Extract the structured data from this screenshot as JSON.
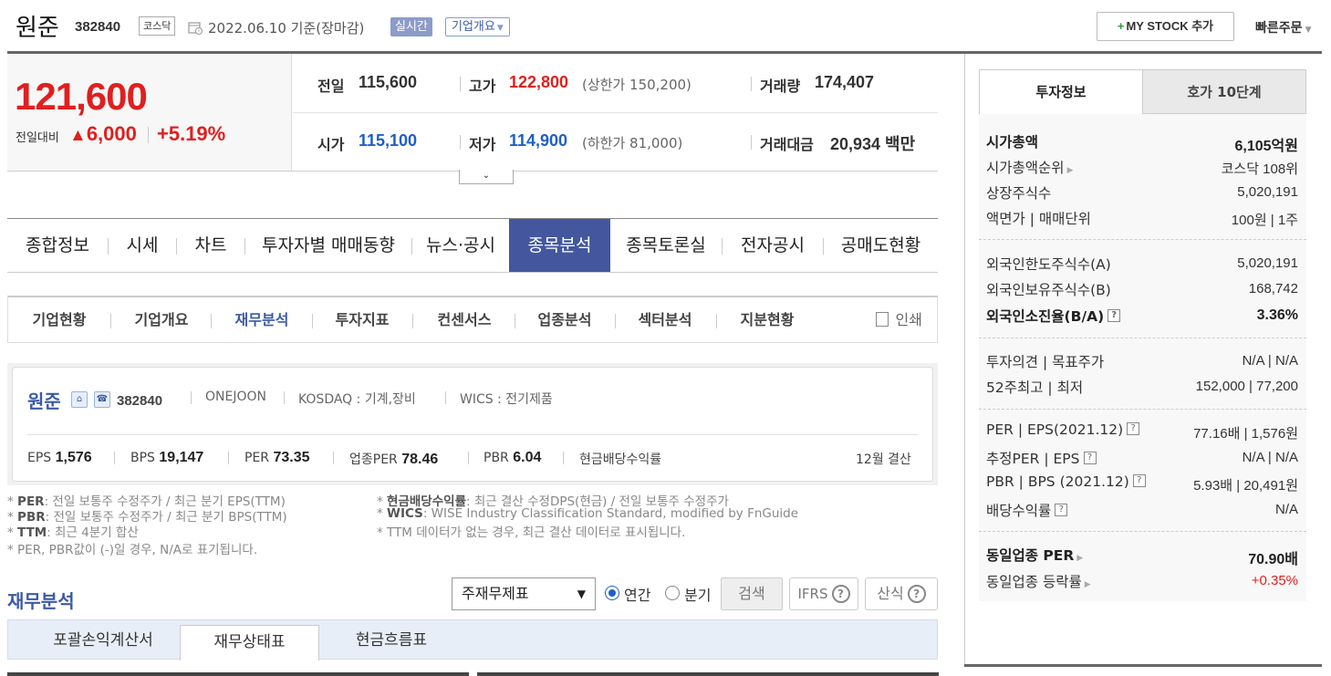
{
  "header": {
    "name": "원준",
    "code": "382840",
    "market_badge": "코스닥",
    "date": "2022.06.10  기준(장마감)",
    "realtime": "실시간",
    "overview": "기업개요",
    "mystock": "MY STOCK 추가",
    "quick_order": "빠른주문"
  },
  "price": {
    "current": "121,600",
    "change_label": "전일대비",
    "change": "6,000",
    "rate": "+5.19%",
    "prev_label": "전일",
    "prev": "115,600",
    "high_label": "고가",
    "high": "122,800",
    "upper_limit": "(상한가 150,200)",
    "volume_label": "거래량",
    "volume": "174,407",
    "open_label": "시가",
    "open": "115,100",
    "low_label": "저가",
    "low": "114,900",
    "lower_limit": "(하한가 81,000)",
    "amount_label": "거래대금",
    "amount": "20,934 백만"
  },
  "main_nav": [
    "종합정보",
    "시세",
    "차트",
    "투자자별 매매동향",
    "뉴스·공시",
    "종목분석",
    "종목토론실",
    "전자공시",
    "공매도현황"
  ],
  "sub_nav": [
    "기업현황",
    "기업개요",
    "재무분석",
    "투자지표",
    "컨센서스",
    "업종분석",
    "섹터분석",
    "지분현황"
  ],
  "print_label": "인쇄",
  "company": {
    "name": "원준",
    "code": "382840",
    "eng": "ONEJOON",
    "industry": "KOSDAQ : 기계,장비",
    "wics": "WICS : 전기제품",
    "eps_label": "EPS",
    "eps": "1,576",
    "bps_label": "BPS",
    "bps": "19,147",
    "per_label": "PER",
    "per": "73.35",
    "ind_per_label": "업종PER",
    "ind_per": "78.46",
    "pbr_label": "PBR",
    "pbr": "6.04",
    "dividend_label": "현금배당수익률",
    "fiscal": "12월 결산"
  },
  "notes": {
    "n1_key": "PER",
    "n1": ": 전일 보통주 수정주가 / 최근 분기 EPS(TTM)",
    "n2_key": "PBR",
    "n2": ": 전일 보통주 수정주가 / 최근 분기 BPS(TTM)",
    "n3_key": "TTM",
    "n3": ": 최근 4분기 합산",
    "n4": "* PER, PBR값이 (-)일 경우, N/A로 표기됩니다.",
    "n5_key": "현금배당수익률",
    "n5": ": 최근 결산 수정DPS(현금) / 전일 보통주 수정주가",
    "n6_key": "WICS",
    "n6": ": WISE Industry Classification Standard, modified by FnGuide",
    "n7": "* TTM 데이터가 없는 경우, 최근 결산 데이터로 표시됩니다."
  },
  "financial": {
    "title": "재무분석",
    "select": "주재무제표",
    "radio_annual": "연간",
    "radio_quarter": "분기",
    "search": "검색",
    "ifrs": "IFRS",
    "formula": "산식",
    "tabs": [
      "포괄손익계산서",
      "재무상태표",
      "현금흐름표"
    ]
  },
  "sidebar": {
    "tab_active": "투자정보",
    "tab_other": "호가 10단계",
    "rows": [
      {
        "k": "시가총액",
        "v": "6,105억원"
      },
      {
        "k": "시가총액순위",
        "v": "코스닥 108위"
      },
      {
        "k": "상장주식수",
        "v": "5,020,191"
      },
      {
        "k": "액면가 | 매매단위",
        "v": "100원 | 1주"
      },
      {
        "k": "외국인한도주식수(A)",
        "v": "5,020,191"
      },
      {
        "k": "외국인보유주식수(B)",
        "v": "168,742"
      },
      {
        "k": "외국인소진율(B/A)",
        "v": "3.36%"
      },
      {
        "k": "투자의견 | 목표주가",
        "v": "N/A | N/A"
      },
      {
        "k": "52주최고 | 최저",
        "v": "152,000 | 77,200"
      },
      {
        "k": "PER | EPS(2021.12)",
        "v": "77.16배 | 1,576원"
      },
      {
        "k": "추정PER | EPS",
        "v": "N/A | N/A"
      },
      {
        "k": "PBR | BPS (2021.12)",
        "v": "5.93배 | 20,491원"
      },
      {
        "k": "배당수익률",
        "v": "N/A"
      },
      {
        "k": "동일업종 PER",
        "v": "70.90배"
      },
      {
        "k": "동일업종 등락률",
        "v": "+0.35%"
      }
    ]
  }
}
